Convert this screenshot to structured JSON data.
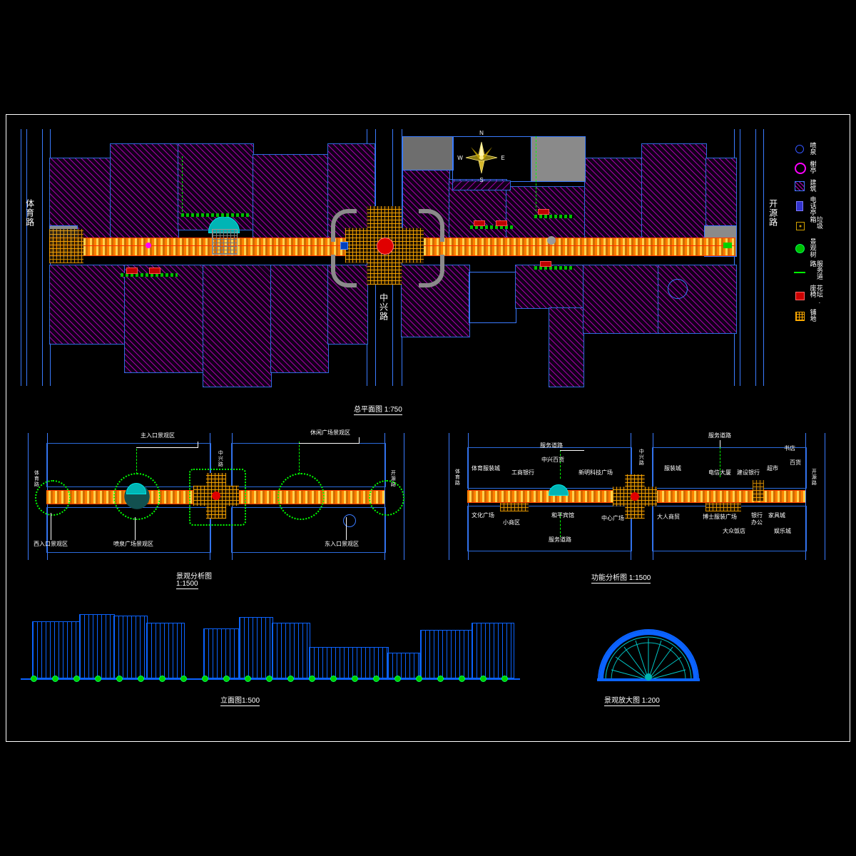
{
  "drawing": {
    "titles": {
      "master_plan": "总平面图 1:750",
      "landscape_analysis": "景观分析图",
      "landscape_analysis_scale": "1:1500",
      "function_analysis": "功能分析图 1:1500",
      "elevation": "立面图1:500",
      "landscape_detail": "景观放大图 1:200"
    },
    "roads": {
      "west": "体育路",
      "center": "中兴路",
      "east": "开源路"
    },
    "compass": {
      "north": "N",
      "south": "S",
      "east": "E",
      "west": "W"
    },
    "legend": [
      {
        "symbol": "fountain-symbol",
        "label": "喷泉",
        "color": "#0040ff"
      },
      {
        "symbol": "pavilion-symbol",
        "label": "榭亭",
        "color": "#ff00ff"
      },
      {
        "symbol": "building-symbol",
        "label": "建筑",
        "color": "#bb00bb"
      },
      {
        "symbol": "telephone-booth-symbol",
        "label": "电话亭",
        "color": "#4d4dff"
      },
      {
        "symbol": "trash-bin-symbol",
        "label": "垃圾箱",
        "color": "#d0a000"
      },
      {
        "symbol": "landscape-tree-symbol",
        "label": "景观树",
        "color": "#00d000"
      },
      {
        "symbol": "service-road-symbol",
        "label": "服务道路",
        "color": "#00ff00"
      },
      {
        "symbol": "flowerbed-bench-symbol",
        "label": "花坛.座椅",
        "color": "#cc0000"
      },
      {
        "symbol": "paving-symbol",
        "label": "铺地",
        "color": "#ffaa00"
      }
    ],
    "landscape_analysis": {
      "callouts": [
        {
          "label": "主入口景观区"
        },
        {
          "label": "休闲广场景观区"
        },
        {
          "label": "中兴路"
        },
        {
          "label": "西入口景观区"
        },
        {
          "label": "喷泉广场景观区"
        },
        {
          "label": "东入口景观区"
        },
        {
          "label": "体育路"
        },
        {
          "label": "开源路"
        }
      ]
    },
    "function_analysis": {
      "callouts": [
        {
          "label": "服务道路"
        },
        {
          "label": "服务道路"
        },
        {
          "label": "中兴百货"
        },
        {
          "label": "新明科技广场"
        },
        {
          "label": "工商银行"
        },
        {
          "label": "体育服装城"
        },
        {
          "label": "中兴路"
        },
        {
          "label": "服装城"
        },
        {
          "label": "电信大厦"
        },
        {
          "label": "建设银行"
        },
        {
          "label": "超市"
        },
        {
          "label": "百货"
        },
        {
          "label": "书店"
        },
        {
          "label": "文化广场"
        },
        {
          "label": "小商区"
        },
        {
          "label": "和平宾馆"
        },
        {
          "label": "中心广场"
        },
        {
          "label": "大人商贸"
        },
        {
          "label": "博士服装广场"
        },
        {
          "label": "银行",
          "sub": "办公"
        },
        {
          "label": "服务道路"
        },
        {
          "label": "家具城"
        },
        {
          "label": "大众饭店"
        },
        {
          "label": "娱乐城"
        },
        {
          "label": "体育路"
        },
        {
          "label": "开源路"
        }
      ]
    }
  }
}
